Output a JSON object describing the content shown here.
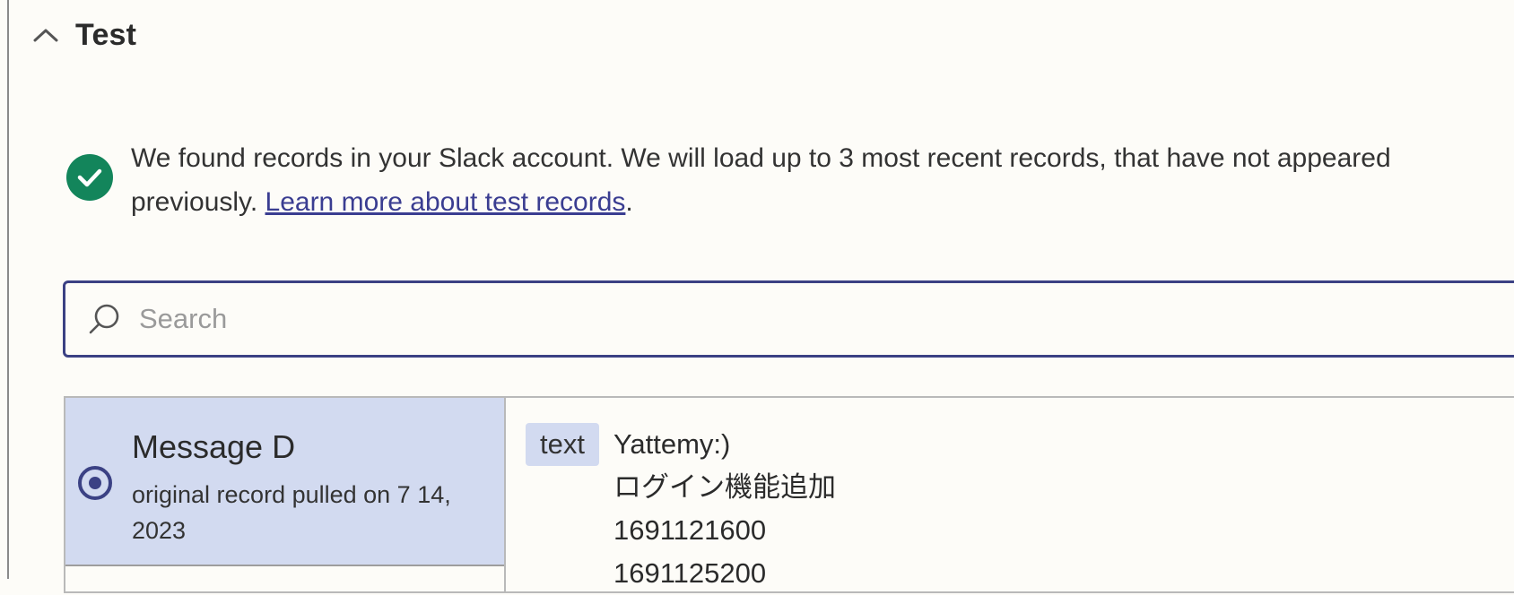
{
  "section": {
    "title": "Test",
    "collapse_icon": "chevron-up-icon"
  },
  "notice": {
    "icon": "check-circle-icon",
    "icon_color": "#13855b",
    "message": "We found records in your Slack account. We will load up to 3 most recent records, that have not appeared previously. ",
    "link_text": "Learn more about test records",
    "trailing": "."
  },
  "search": {
    "icon": "search-icon",
    "placeholder": "Search",
    "value": ""
  },
  "records": {
    "items": [
      {
        "title": "Message D",
        "subtitle": "original record pulled on 7 14, 2023",
        "selected": true
      }
    ],
    "detail": {
      "field_key": "text",
      "lines": [
        "Yattemy:)",
        "ログイン機能追加",
        "1691121600",
        "1691125200"
      ]
    }
  },
  "colors": {
    "accent": "#3b4184",
    "selected_bg": "#d2daf0",
    "link": "#3a3d91",
    "success": "#13855b"
  }
}
